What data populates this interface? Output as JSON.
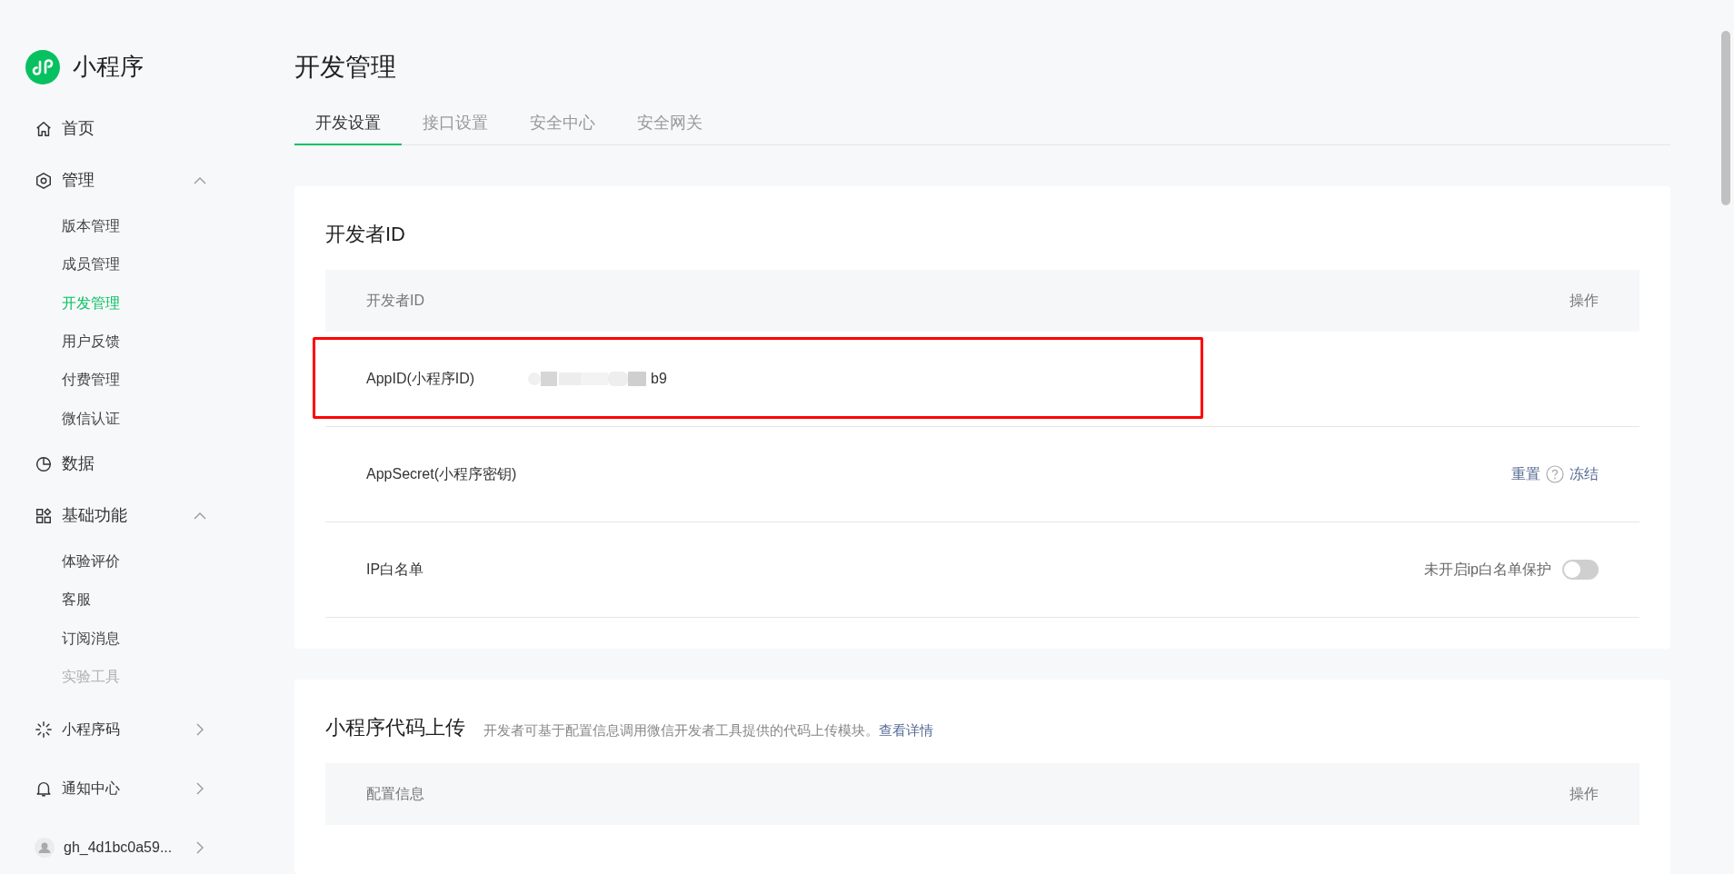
{
  "sidebar": {
    "logo": "小程序",
    "items": [
      {
        "kind": "item",
        "label": "首页"
      },
      {
        "kind": "group",
        "label": "管理",
        "expanded": true,
        "children": [
          {
            "label": "版本管理",
            "selected": false,
            "disabled": false
          },
          {
            "label": "成员管理",
            "selected": false,
            "disabled": false
          },
          {
            "label": "开发管理",
            "selected": true,
            "disabled": false
          },
          {
            "label": "用户反馈",
            "selected": false,
            "disabled": false
          },
          {
            "label": "付费管理",
            "selected": false,
            "disabled": false
          },
          {
            "label": "微信认证",
            "selected": false,
            "disabled": false
          }
        ]
      },
      {
        "kind": "item",
        "label": "数据"
      },
      {
        "kind": "group",
        "label": "基础功能",
        "expanded": true,
        "children": [
          {
            "label": "体验评价",
            "selected": false,
            "disabled": false
          },
          {
            "label": "客服",
            "selected": false,
            "disabled": false
          },
          {
            "label": "订阅消息",
            "selected": false,
            "disabled": false
          },
          {
            "label": "实验工具",
            "selected": false,
            "disabled": true
          }
        ]
      },
      {
        "kind": "link",
        "label": "小程序码"
      },
      {
        "kind": "link",
        "label": "通知中心"
      },
      {
        "kind": "account",
        "label": "gh_4d1bc0a59..."
      }
    ]
  },
  "page_title": "开发管理",
  "tabs": [
    {
      "label": "开发设置",
      "selected": true
    },
    {
      "label": "接口设置",
      "selected": false
    },
    {
      "label": "安全中心",
      "selected": false
    },
    {
      "label": "安全网关",
      "selected": false
    }
  ],
  "developer_id": {
    "title": "开发者ID",
    "columns": [
      "开发者ID",
      "操作"
    ],
    "rows": [
      {
        "kind": "value",
        "label": "AppID(小程序ID)",
        "value": "b9",
        "redacted": true,
        "highlighted": true
      },
      {
        "kind": "links",
        "label": "AppSecret(小程序密钥)",
        "actions": [
          "重置",
          "冻结"
        ],
        "highlighted": false
      },
      {
        "kind": "toggle",
        "label": "IP白名单",
        "toggle_label": "未开启ip白名单保护",
        "on": false,
        "highlighted": false
      }
    ]
  },
  "code_upload": {
    "title": "小程序代码上传",
    "description": "开发者可基于配置信息调用微信开发者工具提供的代码上传模块。",
    "link": "查看详情",
    "columns": [
      "配置信息",
      "操作"
    ]
  }
}
